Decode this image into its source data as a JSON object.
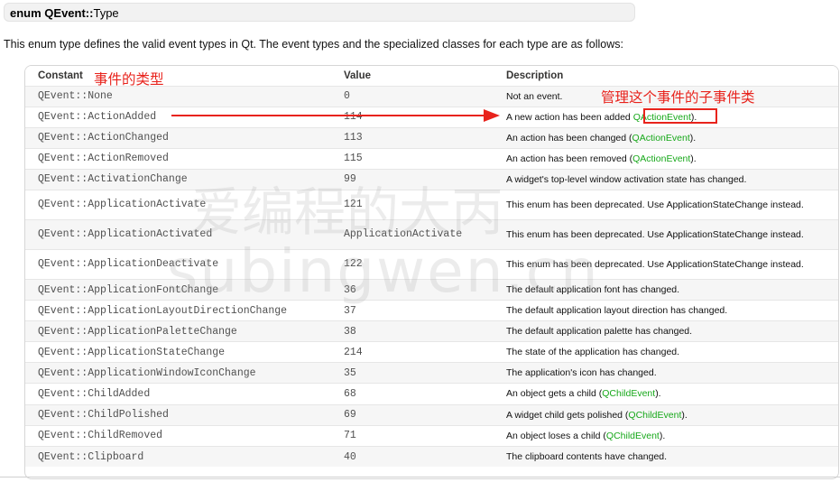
{
  "header": {
    "enum_prefix": "enum QEvent::",
    "enum_name": "Type"
  },
  "intro": "This enum type defines the valid event types in Qt. The event types and the specialized classes for each type are as follows:",
  "table": {
    "columns": [
      "Constant",
      "Value",
      "Description"
    ],
    "rows": [
      {
        "constant": "QEvent::None",
        "value": "0",
        "desc": "Not an event."
      },
      {
        "constant": "QEvent::ActionAdded",
        "value": "114",
        "desc_pre": "A new action has been added ",
        "link": "QActionEvent",
        "desc_post": ")."
      },
      {
        "constant": "QEvent::ActionChanged",
        "value": "113",
        "desc_pre": "An action has been changed (",
        "link": "QActionEvent",
        "desc_post": ")."
      },
      {
        "constant": "QEvent::ActionRemoved",
        "value": "115",
        "desc_pre": "An action has been removed (",
        "link": "QActionEvent",
        "desc_post": ")."
      },
      {
        "constant": "QEvent::ActivationChange",
        "value": "99",
        "desc": "A widget's top-level window activation state has changed."
      },
      {
        "constant": "QEvent::ApplicationActivate",
        "value": "121",
        "desc": "This enum has been deprecated. Use ApplicationStateChange instead."
      },
      {
        "constant": "QEvent::ApplicationActivated",
        "value": "ApplicationActivate",
        "desc": "This enum has been deprecated. Use ApplicationStateChange instead."
      },
      {
        "constant": "QEvent::ApplicationDeactivate",
        "value": "122",
        "desc": "This enum has been deprecated. Use ApplicationStateChange instead."
      },
      {
        "constant": "QEvent::ApplicationFontChange",
        "value": "36",
        "desc": "The default application font has changed."
      },
      {
        "constant": "QEvent::ApplicationLayoutDirectionChange",
        "value": "37",
        "desc": "The default application layout direction has changed."
      },
      {
        "constant": "QEvent::ApplicationPaletteChange",
        "value": "38",
        "desc": "The default application palette has changed."
      },
      {
        "constant": "QEvent::ApplicationStateChange",
        "value": "214",
        "desc": "The state of the application has changed."
      },
      {
        "constant": "QEvent::ApplicationWindowIconChange",
        "value": "35",
        "desc": "The application's icon has changed."
      },
      {
        "constant": "QEvent::ChildAdded",
        "value": "68",
        "desc_pre": "An object gets a child (",
        "link": "QChildEvent",
        "desc_post": ")."
      },
      {
        "constant": "QEvent::ChildPolished",
        "value": "69",
        "desc_pre": "A widget child gets polished (",
        "link": "QChildEvent",
        "desc_post": ")."
      },
      {
        "constant": "QEvent::ChildRemoved",
        "value": "71",
        "desc_pre": "An object loses a child (",
        "link": "QChildEvent",
        "desc_post": ")."
      },
      {
        "constant": "QEvent::Clipboard",
        "value": "40",
        "desc": "The clipboard contents have changed."
      }
    ]
  },
  "annotations": {
    "constant_note": "事件的类型",
    "desc_note": "管理这个事件的子事件类"
  },
  "watermark": {
    "line1": "爱编程的大丙",
    "line2": "subingwen.cn"
  },
  "colors": {
    "link": "#17a81a",
    "annotation_red": "#e8231c"
  }
}
